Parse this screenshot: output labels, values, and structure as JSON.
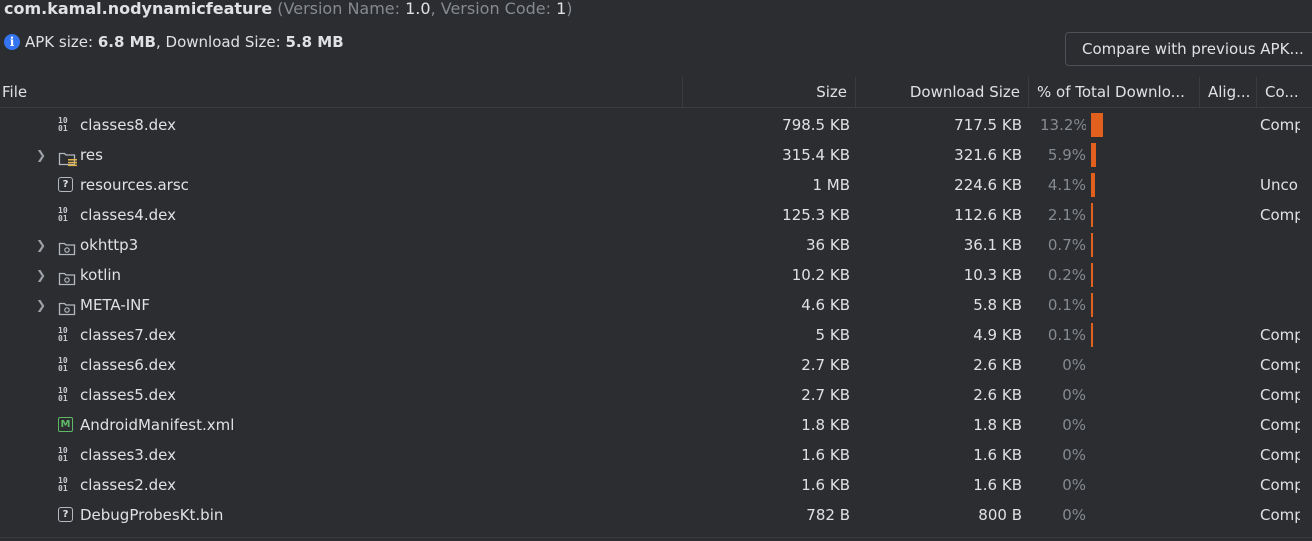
{
  "header": {
    "package": "com.kamal.nodynamicfeature",
    "version_open": " (Version Name: ",
    "version_name": "1.0",
    "version_sep": ", Version Code: ",
    "version_code": "1",
    "version_close": ")"
  },
  "sizes": {
    "apk_label": "APK size: ",
    "apk_value": "6.8 MB",
    "sep": ", Download Size: ",
    "download_value": "5.8 MB"
  },
  "compare_button": "Compare with previous APK...",
  "columns": {
    "file": "File",
    "size": "Size",
    "download": "Download Size",
    "percent": "% of Total Downlo...",
    "align": "Alig...",
    "comp": "Co..."
  },
  "colors": {
    "bar": "#e2601d",
    "accent": "#3574f0"
  },
  "rows": [
    {
      "name": "classes8.dex",
      "icon": "dex-file-icon",
      "expandable": false,
      "size": "798.5 KB",
      "download": "717.5 KB",
      "percent": "13.2%",
      "fraction": 0.132,
      "comp": "Comp"
    },
    {
      "name": "res",
      "icon": "resource-folder-icon",
      "expandable": true,
      "size": "315.4 KB",
      "download": "321.6 KB",
      "percent": "5.9%",
      "fraction": 0.059,
      "comp": ""
    },
    {
      "name": "resources.arsc",
      "icon": "unknown-file-icon",
      "expandable": false,
      "size": "1 MB",
      "download": "224.6 KB",
      "percent": "4.1%",
      "fraction": 0.041,
      "comp": "Unco"
    },
    {
      "name": "classes4.dex",
      "icon": "dex-file-icon",
      "expandable": false,
      "size": "125.3 KB",
      "download": "112.6 KB",
      "percent": "2.1%",
      "fraction": 0.021,
      "comp": "Comp"
    },
    {
      "name": "okhttp3",
      "icon": "package-folder-icon",
      "expandable": true,
      "size": "36 KB",
      "download": "36.1 KB",
      "percent": "0.7%",
      "fraction": 0.007,
      "comp": ""
    },
    {
      "name": "kotlin",
      "icon": "package-folder-icon",
      "expandable": true,
      "size": "10.2 KB",
      "download": "10.3 KB",
      "percent": "0.2%",
      "fraction": 0.002,
      "comp": ""
    },
    {
      "name": "META-INF",
      "icon": "package-folder-icon",
      "expandable": true,
      "size": "4.6 KB",
      "download": "5.8 KB",
      "percent": "0.1%",
      "fraction": 0.001,
      "comp": ""
    },
    {
      "name": "classes7.dex",
      "icon": "dex-file-icon",
      "expandable": false,
      "size": "5 KB",
      "download": "4.9 KB",
      "percent": "0.1%",
      "fraction": 0.001,
      "comp": "Comp"
    },
    {
      "name": "classes6.dex",
      "icon": "dex-file-icon",
      "expandable": false,
      "size": "2.7 KB",
      "download": "2.6 KB",
      "percent": "0%",
      "fraction": 0,
      "comp": "Comp"
    },
    {
      "name": "classes5.dex",
      "icon": "dex-file-icon",
      "expandable": false,
      "size": "2.7 KB",
      "download": "2.6 KB",
      "percent": "0%",
      "fraction": 0,
      "comp": "Comp"
    },
    {
      "name": "AndroidManifest.xml",
      "icon": "manifest-file-icon",
      "expandable": false,
      "size": "1.8 KB",
      "download": "1.8 KB",
      "percent": "0%",
      "fraction": 0,
      "comp": "Comp"
    },
    {
      "name": "classes3.dex",
      "icon": "dex-file-icon",
      "expandable": false,
      "size": "1.6 KB",
      "download": "1.6 KB",
      "percent": "0%",
      "fraction": 0,
      "comp": "Comp"
    },
    {
      "name": "classes2.dex",
      "icon": "dex-file-icon",
      "expandable": false,
      "size": "1.6 KB",
      "download": "1.6 KB",
      "percent": "0%",
      "fraction": 0,
      "comp": "Comp"
    },
    {
      "name": "DebugProbesKt.bin",
      "icon": "unknown-file-icon",
      "expandable": false,
      "size": "782 B",
      "download": "800 B",
      "percent": "0%",
      "fraction": 0,
      "comp": "Comp"
    }
  ]
}
